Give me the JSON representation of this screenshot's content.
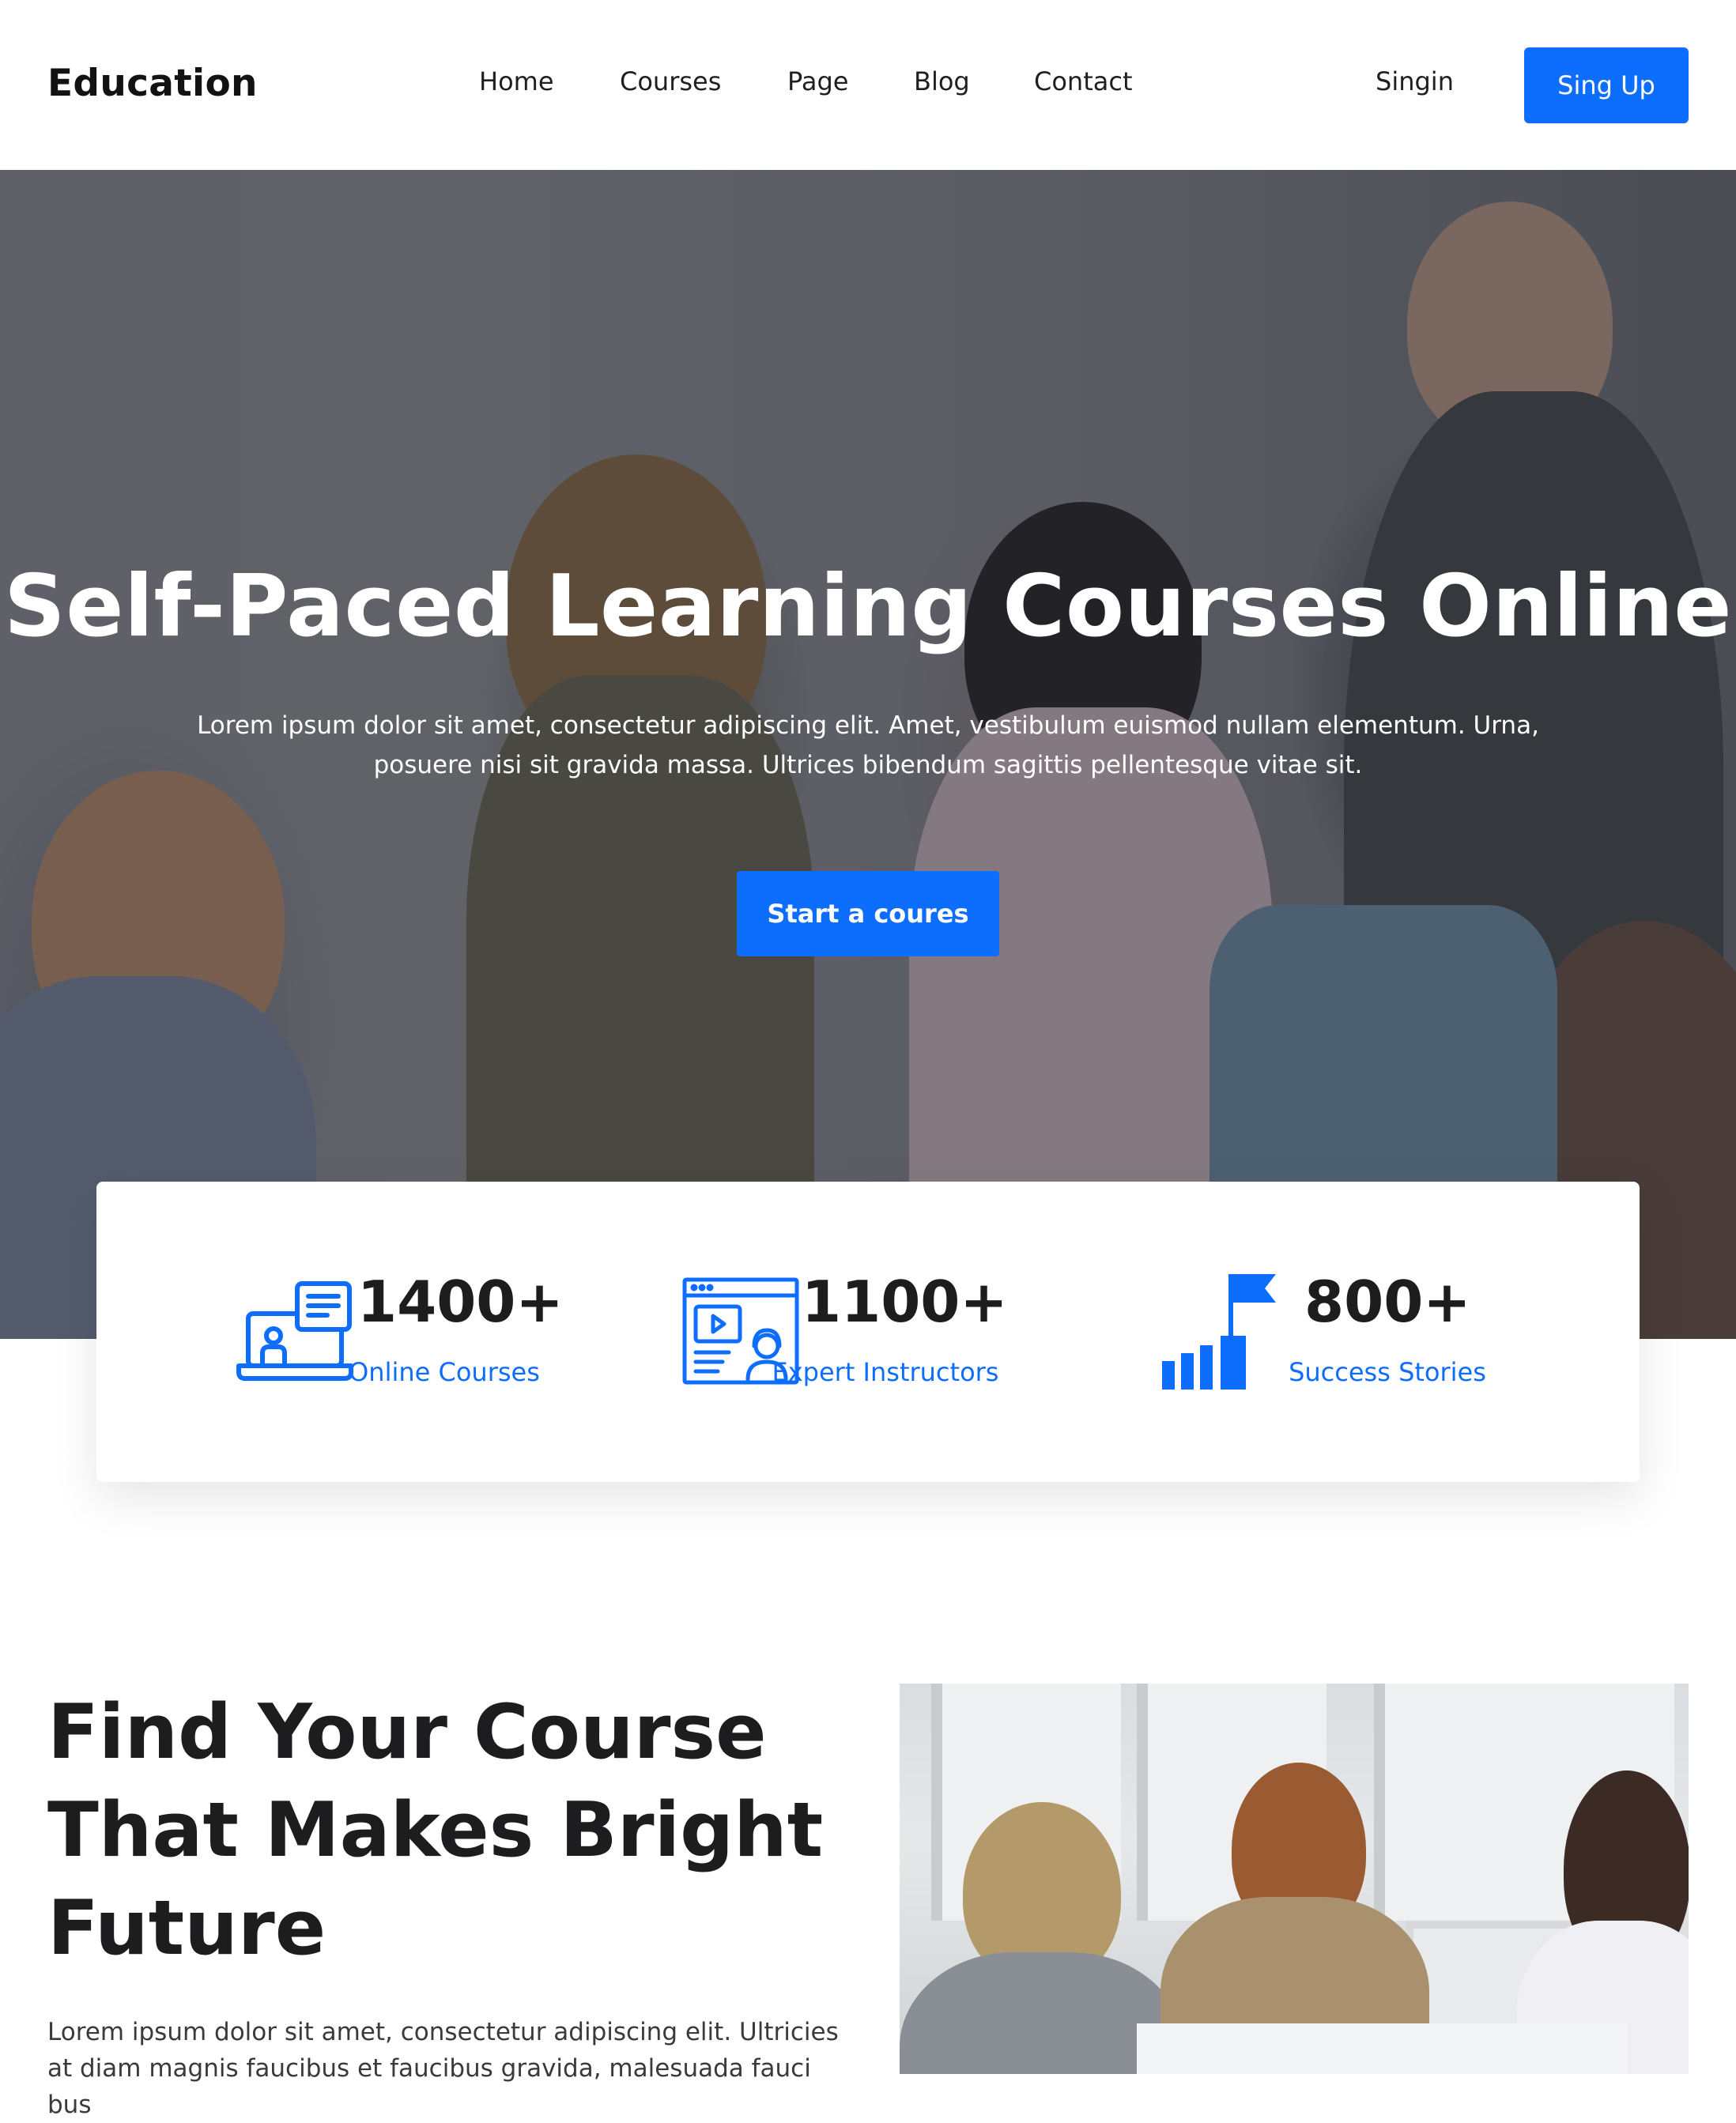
{
  "navbar": {
    "brand": "Education",
    "links": [
      "Home",
      "Courses",
      "Page",
      "Blog",
      "Contact"
    ],
    "signin": "Singin",
    "signup": "Sing Up"
  },
  "hero": {
    "title": "Self-Paced Learning Courses Online",
    "subtitle": "Lorem ipsum dolor sit amet, consectetur adipiscing elit. Amet, vestibulum euismod nullam elementum. Urna, posuere nisi sit gravida massa. Ultrices bibendum sagittis pellentesque vitae sit.",
    "cta": "Start a coures"
  },
  "stats": [
    {
      "icon": "online-class-icon",
      "value": "1400+",
      "label": "Online Courses"
    },
    {
      "icon": "video-instructor-icon",
      "value": "1100+",
      "label": "Expert Instructors"
    },
    {
      "icon": "growth-flag-icon",
      "value": "800+",
      "label": "Success Stories"
    }
  ],
  "find_course": {
    "title_lines": [
      "Find Your Course",
      "That Makes Bright",
      "Future"
    ],
    "text": "Lorem ipsum dolor sit amet, consectetur adipiscing elit. Ultricies at diam magnis faucibus et faucibus gravida, malesuada fauci bus"
  },
  "colors": {
    "accent": "#0d6efd",
    "text_dark": "#1d1d1f",
    "white": "#ffffff"
  }
}
